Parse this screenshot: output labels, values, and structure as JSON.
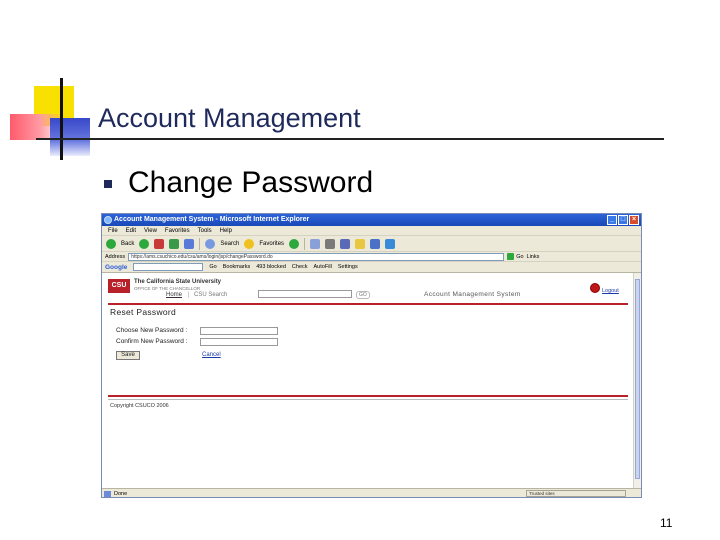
{
  "slide": {
    "title": "Account Management",
    "bullet": "Change Password",
    "page_number": "11"
  },
  "browser": {
    "window_title": "Account Management System - Microsoft Internet Explorer",
    "menu": [
      "File",
      "Edit",
      "View",
      "Favorites",
      "Tools",
      "Help"
    ],
    "toolbar": {
      "back_label": "Back",
      "search_label": "Search",
      "favorites_label": "Favorites"
    },
    "address": {
      "label": "Address",
      "url": "https://ams.csuchico.edu/csu/ams/login/jsp/changePassword.do",
      "go_label": "Go",
      "links_label": "Links"
    },
    "google": {
      "logo": "Google",
      "go_label": "Go",
      "bookmarks_label": "Bookmarks",
      "blocked_label": "493 blocked",
      "check_label": "Check",
      "autofill_label": "AutoFill",
      "settings_label": "Settings"
    },
    "status": {
      "text": "Done",
      "zone": "Trusted sites"
    }
  },
  "page": {
    "university_name": "The California State University",
    "university_sub": "OFFICE OF THE CHANCELLOR",
    "nav_home": "Home",
    "nav_csu_search": "CSU Search",
    "search_go": "GO",
    "system_title": "Account Management System",
    "logout_label": "Logout",
    "logo_text": "CSU",
    "reset_heading": "Reset Password",
    "choose_label": "Choose New Password :",
    "confirm_label": "Confirm New Password :",
    "save_label": "Save",
    "cancel_label": "Cancel",
    "copyright": "Copyright CSUCO 2006"
  }
}
